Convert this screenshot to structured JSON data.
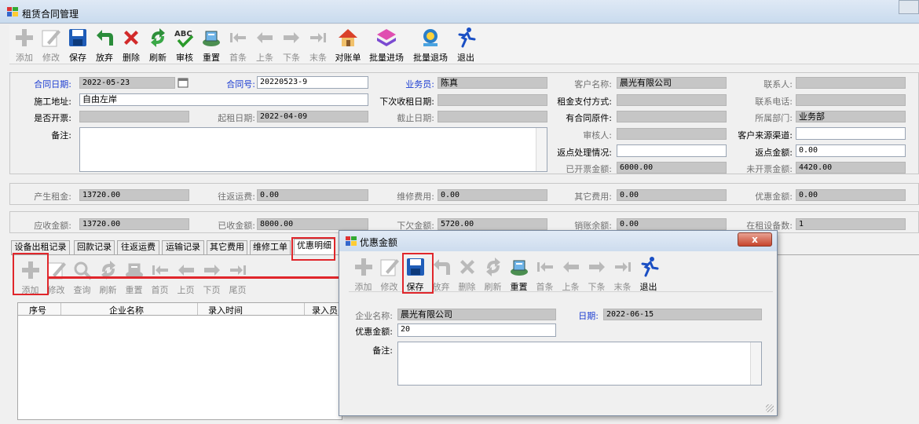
{
  "window": {
    "title": "租赁合同管理"
  },
  "toolbar": [
    {
      "name": "add",
      "label": "添加",
      "icon": "plus-icon",
      "disabled": true
    },
    {
      "name": "edit",
      "label": "修改",
      "icon": "edit-icon",
      "disabled": true
    },
    {
      "name": "save",
      "label": "保存",
      "icon": "save-icon",
      "disabled": false
    },
    {
      "name": "discard",
      "label": "放弃",
      "icon": "undo-icon",
      "disabled": false
    },
    {
      "name": "delete",
      "label": "删除",
      "icon": "delete-icon",
      "disabled": false
    },
    {
      "name": "refresh",
      "label": "刷新",
      "icon": "refresh-icon",
      "disabled": false
    },
    {
      "name": "audit",
      "label": "审核",
      "icon": "spellcheck-icon",
      "disabled": false
    },
    {
      "name": "reset",
      "label": "重置",
      "icon": "reset-icon",
      "disabled": false
    },
    {
      "name": "first",
      "label": "首条",
      "icon": "first-icon",
      "disabled": true
    },
    {
      "name": "prev",
      "label": "上条",
      "icon": "prev-icon",
      "disabled": true
    },
    {
      "name": "next",
      "label": "下条",
      "icon": "next-icon",
      "disabled": true
    },
    {
      "name": "last",
      "label": "末条",
      "icon": "last-icon",
      "disabled": true
    },
    {
      "name": "statement",
      "label": "对账单",
      "icon": "house-icon",
      "disabled": false
    },
    {
      "name": "batch-in",
      "label": "批量进场",
      "icon": "batch-in-icon",
      "disabled": false
    },
    {
      "name": "batch-out",
      "label": "批量退场",
      "icon": "batch-out-icon",
      "disabled": false
    },
    {
      "name": "exit",
      "label": "退出",
      "icon": "run-icon",
      "disabled": false
    }
  ],
  "contract": {
    "date_label": "合同日期:",
    "date": "2022-05-23",
    "no_label": "合同号:",
    "no": "20220523-9",
    "salesman_label": "业务员:",
    "salesman": "陈真",
    "customer_label": "客户名称:",
    "customer": "晨光有限公司",
    "contact_label": "联系人:",
    "contact": "",
    "site_label": "施工地址:",
    "site": "自由左岸",
    "next_collect_label": "下次收租日期:",
    "next_collect": "",
    "pay_method_label": "租金支付方式:",
    "pay_method": "",
    "phone_label": "联系电话:",
    "phone": "",
    "invoice_label": "是否开票:",
    "invoice": "",
    "start_label": "起租日期:",
    "start": "2022-04-09",
    "end_label": "截止日期:",
    "end": "",
    "original_label": "有合同原件:",
    "original": "",
    "dept_label": "所属部门:",
    "dept": "业务部",
    "remark_label": "备注:",
    "remark": "",
    "auditor_label": "审核人:",
    "auditor": "",
    "channel_label": "客户来源渠道:",
    "channel": "",
    "rebate_status_label": "返点处理情况:",
    "rebate_status": "",
    "rebate_amount_label": "返点金额:",
    "rebate_amount": "0.00",
    "invoiced_label": "已开票金额:",
    "invoiced": "6000.00",
    "uninvoiced_label": "未开票金额:",
    "uninvoiced": "4420.00"
  },
  "fees": {
    "rent_label": "产生租金:",
    "rent": "13720.00",
    "freight_label": "往返运费:",
    "freight": "0.00",
    "repair_label": "维修费用:",
    "repair": "0.00",
    "other_label": "其它费用:",
    "other": "0.00",
    "discount_label": "优惠金额:",
    "discount": "0.00"
  },
  "totals": {
    "receivable_label": "应收金额:",
    "receivable": "13720.00",
    "received_label": "已收金额:",
    "received": "8000.00",
    "owed_label": "下欠金额:",
    "owed": "5720.00",
    "writeoff_label": "销账余额:",
    "writeoff": "0.00",
    "equipment_label": "在租设备数:",
    "equipment": "1"
  },
  "tabs": [
    "设备出租记录",
    "回款记录",
    "往返运费",
    "运输记录",
    "其它费用",
    "维修工单",
    "优惠明细"
  ],
  "tab_toolbar": [
    {
      "name": "add",
      "label": "添加",
      "icon": "plus-icon"
    },
    {
      "name": "edit",
      "label": "修改",
      "icon": "edit-icon"
    },
    {
      "name": "query",
      "label": "查询",
      "icon": "search-icon"
    },
    {
      "name": "refresh",
      "label": "刷新",
      "icon": "refresh-icon"
    },
    {
      "name": "reset",
      "label": "重置",
      "icon": "reset-icon"
    },
    {
      "name": "first",
      "label": "首页",
      "icon": "first-icon"
    },
    {
      "name": "prev",
      "label": "上页",
      "icon": "prev-icon"
    },
    {
      "name": "next",
      "label": "下页",
      "icon": "next-icon"
    },
    {
      "name": "last",
      "label": "尾页",
      "icon": "last-icon"
    }
  ],
  "grid": {
    "columns": [
      "序号",
      "企业名称",
      "录入时间",
      "录入员"
    ]
  },
  "dialog": {
    "title": "优惠金额",
    "close": "x",
    "toolbar": [
      {
        "name": "add",
        "label": "添加",
        "icon": "plus-icon",
        "disabled": true
      },
      {
        "name": "edit",
        "label": "修改",
        "icon": "edit-icon",
        "disabled": true
      },
      {
        "name": "save",
        "label": "保存",
        "icon": "save-icon",
        "disabled": false
      },
      {
        "name": "discard",
        "label": "放弃",
        "icon": "undo-icon",
        "disabled": true
      },
      {
        "name": "delete",
        "label": "删除",
        "icon": "delete-icon",
        "disabled": true
      },
      {
        "name": "refresh",
        "label": "刷新",
        "icon": "refresh-icon",
        "disabled": true
      },
      {
        "name": "reset",
        "label": "重置",
        "icon": "reset-icon",
        "disabled": false
      },
      {
        "name": "first",
        "label": "首条",
        "icon": "first-icon",
        "disabled": true
      },
      {
        "name": "prev",
        "label": "上条",
        "icon": "prev-icon",
        "disabled": true
      },
      {
        "name": "next",
        "label": "下条",
        "icon": "next-icon",
        "disabled": true
      },
      {
        "name": "last",
        "label": "末条",
        "icon": "last-icon",
        "disabled": true
      },
      {
        "name": "exit",
        "label": "退出",
        "icon": "run-icon",
        "disabled": false
      }
    ],
    "company_label": "企业名称:",
    "company": "晨光有限公司",
    "date_label": "日期:",
    "date": "2022-06-15",
    "amount_label": "优惠金额:",
    "amount": "20",
    "remark_label": "备注:",
    "remark": ""
  },
  "colors": {
    "label_blue": "#1a3bd1",
    "highlight_red": "#e0262b",
    "readonly_gray": "#c6c6c6"
  }
}
